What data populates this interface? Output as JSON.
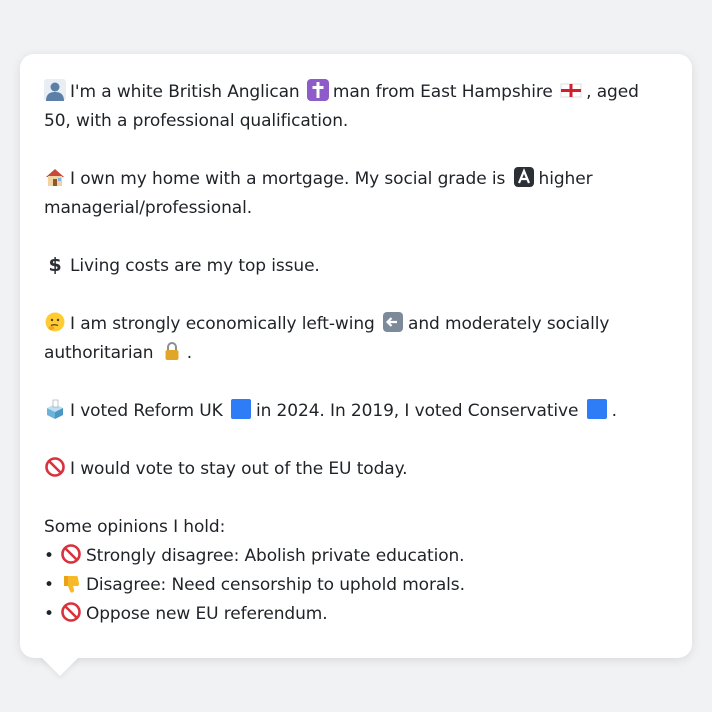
{
  "message": {
    "identity": {
      "pre": "I'm a white British Anglican",
      "mid": "man from East Hampshire",
      "post": ", aged 50, with a professional qualification."
    },
    "home": {
      "pre": "I own my home with a mortgage. My social grade is",
      "post": "higher managerial/professional."
    },
    "issue": {
      "text": "Living costs are my top issue."
    },
    "politics": {
      "pre": "I am strongly economically left-wing",
      "mid": "and moderately socially authoritarian",
      "post": "."
    },
    "votes": {
      "pre": "I voted Reform UK",
      "mid": "in 2024. In 2019, I voted Conservative",
      "post": "."
    },
    "eu": {
      "text": "I would vote to stay out of the EU today."
    },
    "opinions": {
      "heading": "Some opinions I hold:",
      "bullet": "•",
      "items": [
        {
          "text": "Strongly disagree: Abolish private education."
        },
        {
          "text": "Disagree: Need censorship to uphold morals."
        },
        {
          "text": "Oppose new EU referendum."
        }
      ]
    }
  },
  "icons": {
    "person": "person-silhouette-icon",
    "cross": "latin-cross-icon",
    "flag": "england-flag-icon",
    "house": "house-icon",
    "grade": "letter-a-icon",
    "dollar": "dollar-sign-icon",
    "thinking": "thinking-face-icon",
    "left_arrow": "left-arrow-icon",
    "lock": "lock-icon",
    "ballot": "ballot-box-icon",
    "blue_square": "blue-square-icon",
    "prohibited": "prohibited-icon",
    "thumbs_down": "thumbs-down-icon"
  },
  "colors": {
    "background": "#f1f2f4",
    "bubble": "#ffffff",
    "text": "#1f2328",
    "reform_blue": "#2f7df6",
    "conservative_blue": "#2f7df6",
    "prohibited_red": "#d8323c"
  }
}
